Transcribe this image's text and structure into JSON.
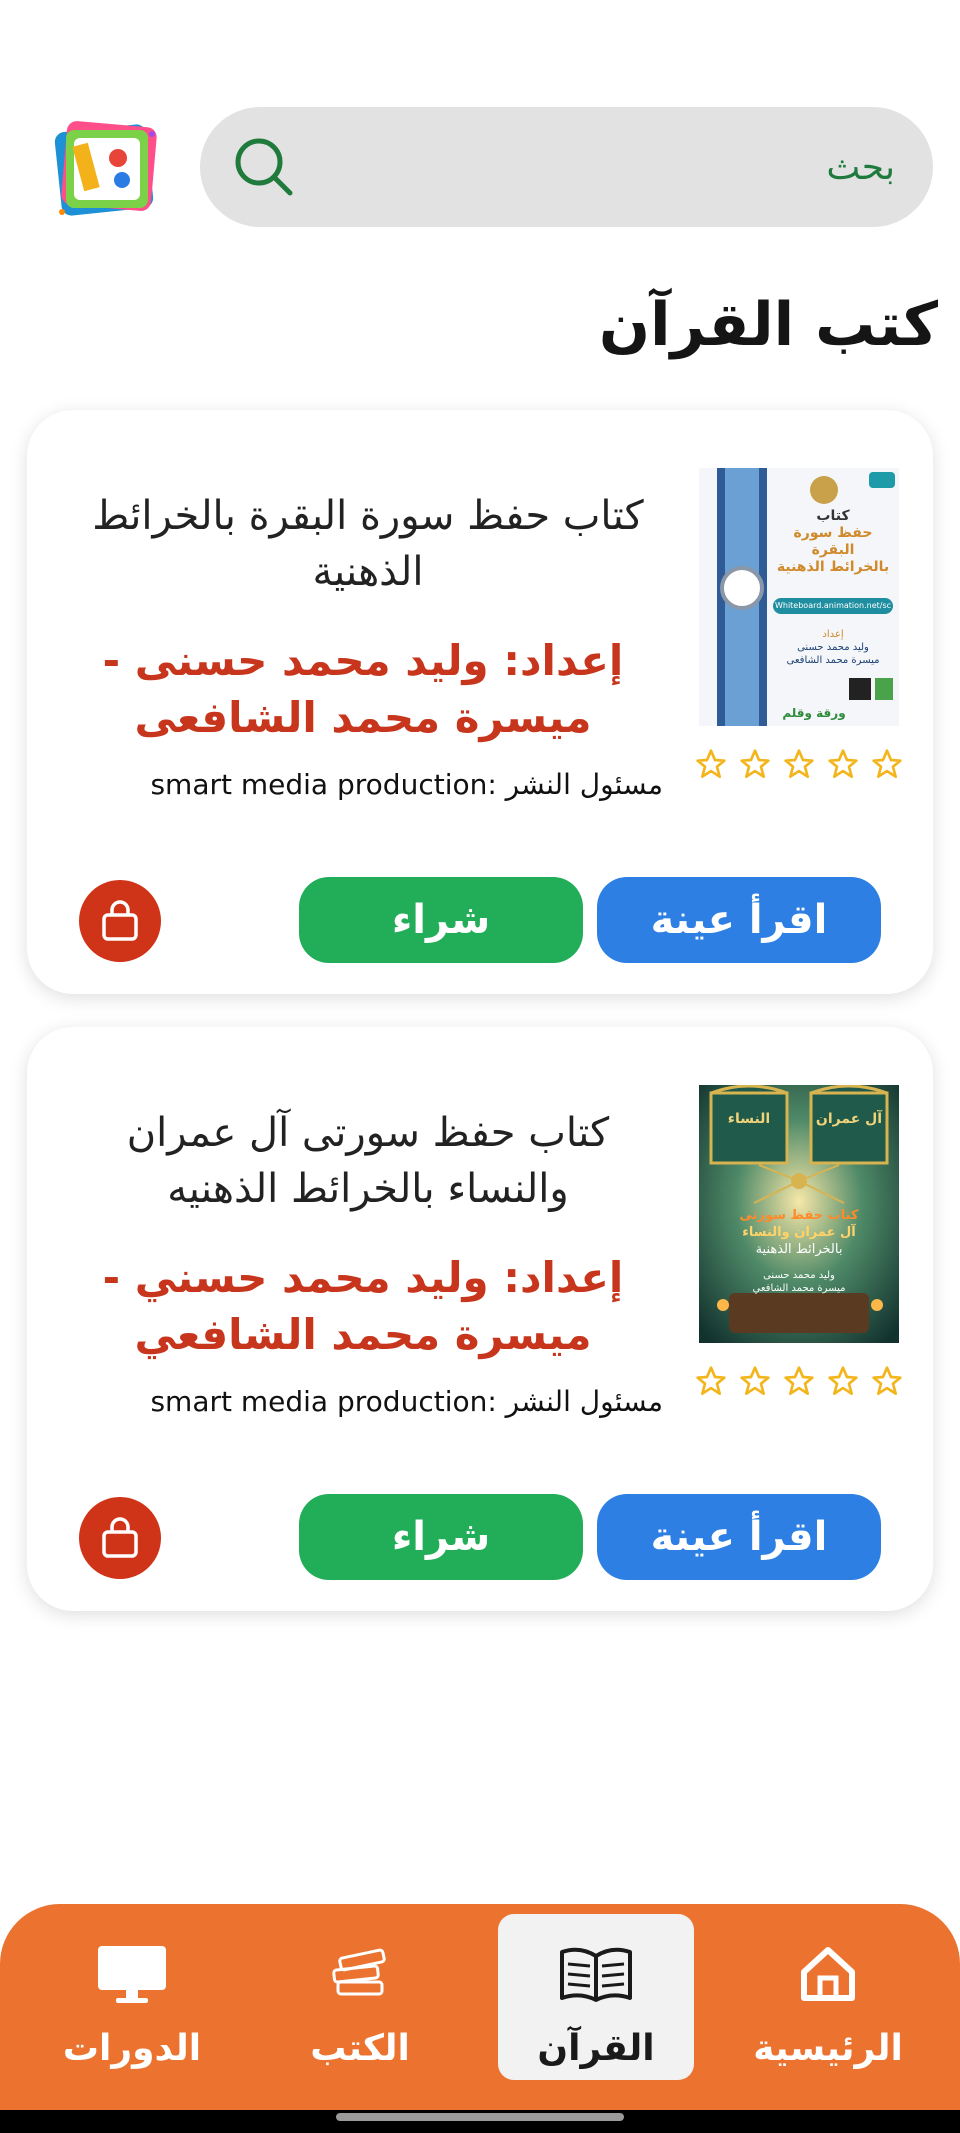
{
  "search": {
    "placeholder": "بحث"
  },
  "page_title": "كتب القرآن",
  "books": [
    {
      "title": "كتاب حفظ سورة البقرة بالخرائط الذهنية",
      "author": "إعداد: وليد محمد حسنى - ميسرة محمد الشافعى",
      "publisher": "مسئول النشر :smart media production",
      "rating": 0,
      "cover": {
        "heading": "كتاب",
        "subtitle": "حفظ سورة البقرة",
        "subtitle2": "بالخرائط الذهنية",
        "url_text": "Whiteboard.animation.net/sc",
        "prepared": "إعداد",
        "names": "وليد محمد حسنى",
        "names2": "ميسرة محمد الشافعى",
        "brand": "ورقة وقلم"
      },
      "read_label": "اقرأ عينة",
      "buy_label": "شراء"
    },
    {
      "title": "كتاب حفظ سورتى آل عمران والنساء بالخرائط الذهنيه",
      "author": "إعداد: وليد محمد حسني - ميسرة محمد الشافعي",
      "publisher": "مسئول النشر :smart media production",
      "rating": 0,
      "cover": {
        "left_arch": "النساء",
        "right_arch": "آل عمران",
        "subtitle": "كتاب حفظ سورتى",
        "subtitle2": "آل عمران والنساء",
        "subtitle3": "بالخرائط الذهنية",
        "names": "وليد محمد حسنى",
        "names2": "ميسرة محمد الشافعي"
      },
      "read_label": "اقرأ عينة",
      "buy_label": "شراء"
    }
  ],
  "nav": {
    "items": [
      {
        "label": "الرئيسية",
        "icon": "home-icon"
      },
      {
        "label": "القرآن",
        "icon": "quran-book-icon",
        "active": true
      },
      {
        "label": "الكتب",
        "icon": "books-stack-icon"
      },
      {
        "label": "الدورات",
        "icon": "monitor-icon"
      }
    ]
  },
  "colors": {
    "accent_orange": "#ec7230",
    "read_blue": "#2d7fe3",
    "buy_green": "#22ad58",
    "author_red": "#c7351c",
    "star_gold": "#f2b51b"
  }
}
